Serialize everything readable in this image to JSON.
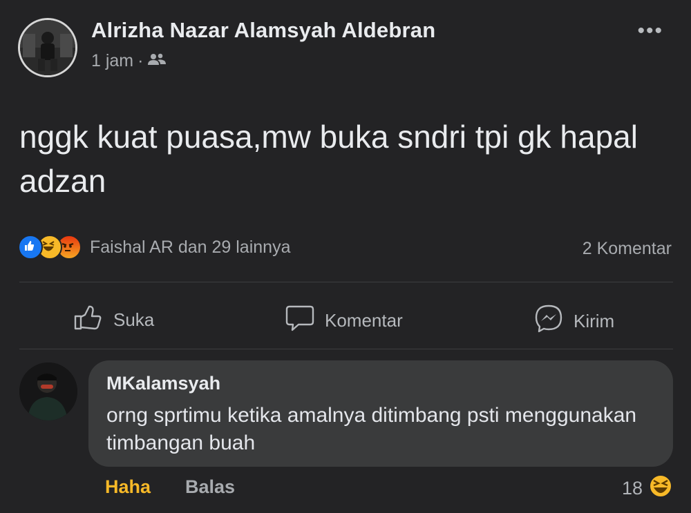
{
  "post": {
    "author": "Alrizha Nazar Alamsyah Aldebran",
    "time": "1 jam",
    "separator": "·",
    "audience_icon": "friends-icon",
    "menu_label": "•••",
    "text": "nggk kuat puasa,mw buka sndri tpi gk hapal adzan"
  },
  "reactions": {
    "icons": [
      "like-icon",
      "haha-icon",
      "angry-icon"
    ],
    "summary": "Faishal AR dan 29 lainnya",
    "comment_count": "2 Komentar"
  },
  "actions": {
    "like_label": "Suka",
    "comment_label": "Komentar",
    "send_label": "Kirim"
  },
  "comment": {
    "author": "MKalamsyah",
    "text": "orng sprtimu ketika amalnya ditimbang psti menggunakan timbangan buah",
    "haha_label": "Haha",
    "reply_label": "Balas",
    "reaction_count": "18",
    "reaction_icon": "haha-icon"
  },
  "colors": {
    "background": "#232325",
    "bubble": "#3a3b3c",
    "like_blue": "#1877f2",
    "haha_yellow": "#f7b928",
    "angry_orange": "#e9710f"
  }
}
